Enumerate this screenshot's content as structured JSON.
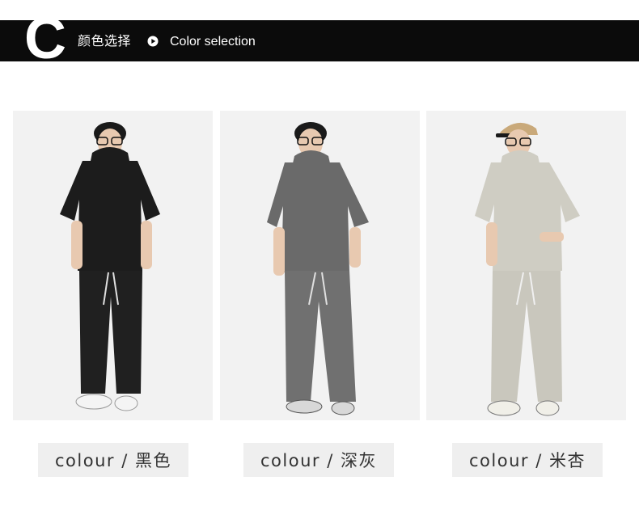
{
  "header": {
    "letter": "C",
    "title_cn": "颜色选择",
    "play_icon": "play-circle-icon",
    "title_en": "Color selection"
  },
  "colors": [
    {
      "label": "colour / 黑色",
      "shirt": "#1c1c1c",
      "pants": "#202020",
      "cap": ""
    },
    {
      "label": "colour / 深灰",
      "shirt": "#6a6a6a",
      "pants": "#707070",
      "cap": ""
    },
    {
      "label": "colour / 米杏",
      "shirt": "#cfcdc3",
      "pants": "#c9c7bd",
      "cap": "#c9a97a"
    }
  ]
}
